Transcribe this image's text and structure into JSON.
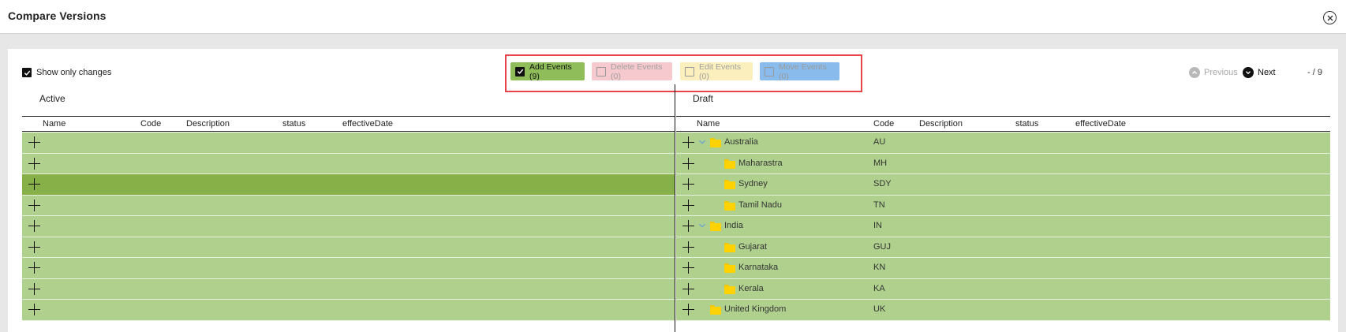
{
  "dialog": {
    "title": "Compare Versions"
  },
  "toolbar": {
    "show_only_changes": "Show only changes",
    "filters": {
      "add": "Add Events (9)",
      "delete": "Delete Events (0)",
      "edit": "Edit Events (0)",
      "move": "Move Events (0)"
    },
    "previous": "Previous",
    "next": "Next",
    "counter": "- / 9"
  },
  "active": {
    "label": "Active",
    "columns": {
      "name": "Name",
      "code": "Code",
      "description": "Description",
      "status": "status",
      "effective_date": "effectiveDate"
    }
  },
  "draft": {
    "label": "Draft",
    "columns": {
      "name": "Name",
      "code": "Code",
      "description": "Description",
      "status": "status",
      "effective_date": "effectiveDate"
    },
    "rows": [
      {
        "name": "Australia",
        "code": "AU"
      },
      {
        "name": "Maharastra",
        "code": "MH"
      },
      {
        "name": "Sydney",
        "code": "SDY"
      },
      {
        "name": "Tamil Nadu",
        "code": "TN"
      },
      {
        "name": "India",
        "code": "IN"
      },
      {
        "name": "Gujarat",
        "code": "GUJ"
      },
      {
        "name": "Karnataka",
        "code": "KN"
      },
      {
        "name": "Kerala",
        "code": "KA"
      },
      {
        "name": "United Kingdom",
        "code": "UK"
      }
    ]
  },
  "colors": {
    "add": "#8fbd5a",
    "delete": "#f5c9cd",
    "edit": "#fbefbd",
    "move": "#89bcec",
    "row_added": "#b0d18e",
    "row_selected": "#88b049",
    "highlight_border": "#e8434b",
    "folder": "#ffd200"
  },
  "icons": {
    "close": "close-circle-icon",
    "checkbox": "checkbox-icon",
    "previous": "chevron-up-circle-icon",
    "next": "chevron-down-circle-icon",
    "add_row": "plus-icon",
    "expand": "chevron-down-icon",
    "folder": "folder-icon"
  }
}
